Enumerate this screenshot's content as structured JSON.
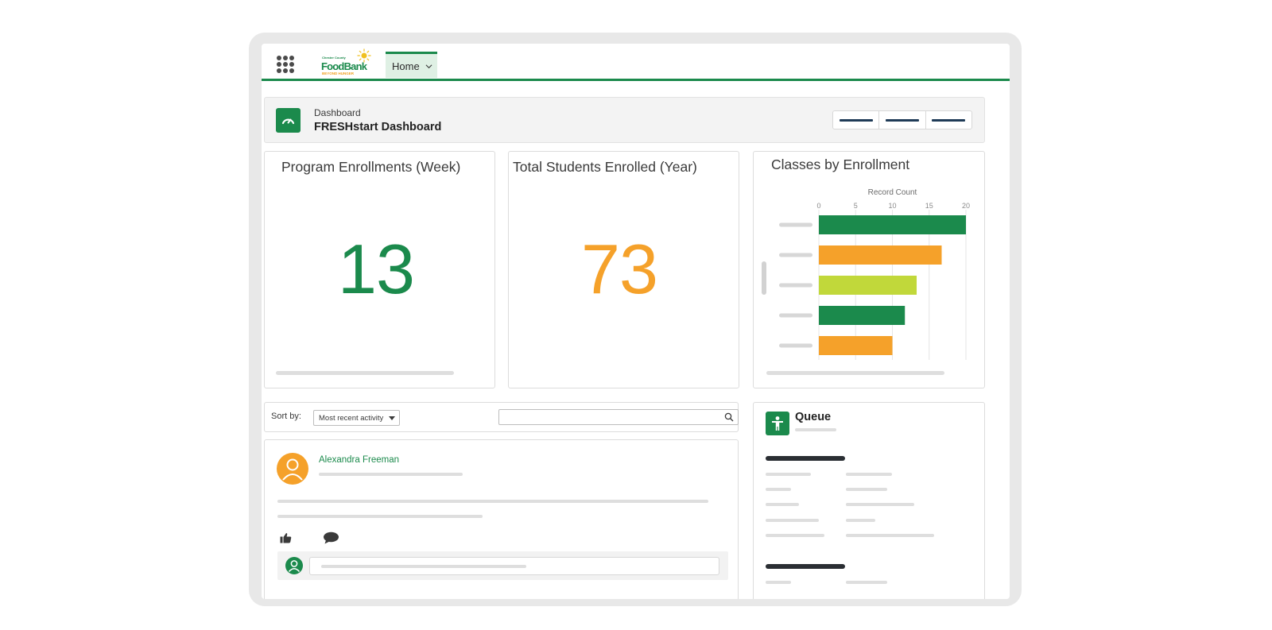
{
  "app": {
    "logo": {
      "top_text": "Chester County",
      "main_text": "FoodBank",
      "sub_text": "BEYOND HUNGER"
    },
    "nav_tabs": [
      {
        "label": "Home",
        "active": true
      }
    ],
    "accent_color": "#1b8a4c"
  },
  "dashboard": {
    "kicker": "Dashboard",
    "title": "FRESHstart Dashboard"
  },
  "metrics": [
    {
      "title": "Program Enrollments (Week)",
      "value": "13",
      "color": "#1b8a4c"
    },
    {
      "title": "Total Students Enrolled (Year)",
      "value": "73",
      "color": "#f5a12a"
    }
  ],
  "classes_chart": {
    "title": "Classes by Enrollment"
  },
  "chart_data": {
    "type": "bar",
    "orientation": "horizontal",
    "title": "Classes by Enrollment",
    "xlabel": "Record Count",
    "ylabel": "",
    "x_ticks": [
      "0",
      "5",
      "10",
      "15",
      "20"
    ],
    "xlim": [
      0,
      20
    ],
    "categories": [
      "",
      "",
      "",
      "",
      ""
    ],
    "values": [
      20,
      16.7,
      13.3,
      11.7,
      10
    ],
    "colors": [
      "#1b8a4c",
      "#f5a12a",
      "#c1d83a",
      "#1b8a4c",
      "#f5a12a"
    ],
    "grid": true
  },
  "feed": {
    "sort_label": "Sort by:",
    "sort_value": "Most recent activity",
    "search_placeholder": "",
    "post": {
      "author": "Alexandra Freeman"
    }
  },
  "queue": {
    "title": "Queue"
  }
}
